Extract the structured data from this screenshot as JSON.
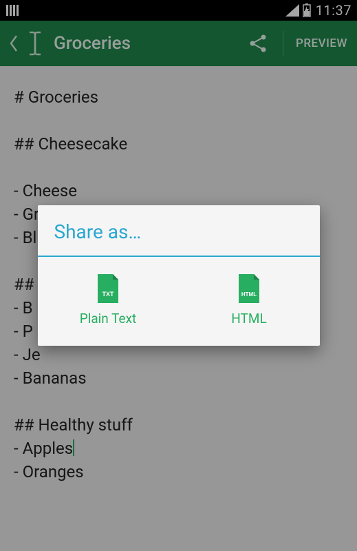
{
  "statusbar": {
    "time": "11:37"
  },
  "appbar": {
    "title": "Groceries",
    "preview_label": "PREVIEW"
  },
  "editor": {
    "lines": [
      "# Groceries",
      "",
      "## Cheesecake",
      "",
      "- Cheese",
      "- Graham crackers",
      "- Bl",
      "",
      "## ",
      "- B",
      "- P",
      "- Je",
      "- Bananas",
      "",
      "## Healthy stuff",
      "- Apples",
      "- Oranges"
    ],
    "cursor_line": 15
  },
  "dialog": {
    "title": "Share as…",
    "options": [
      {
        "label": "Plain Text",
        "icon_text": "TXT"
      },
      {
        "label": "HTML",
        "icon_text": "HTML"
      }
    ]
  }
}
